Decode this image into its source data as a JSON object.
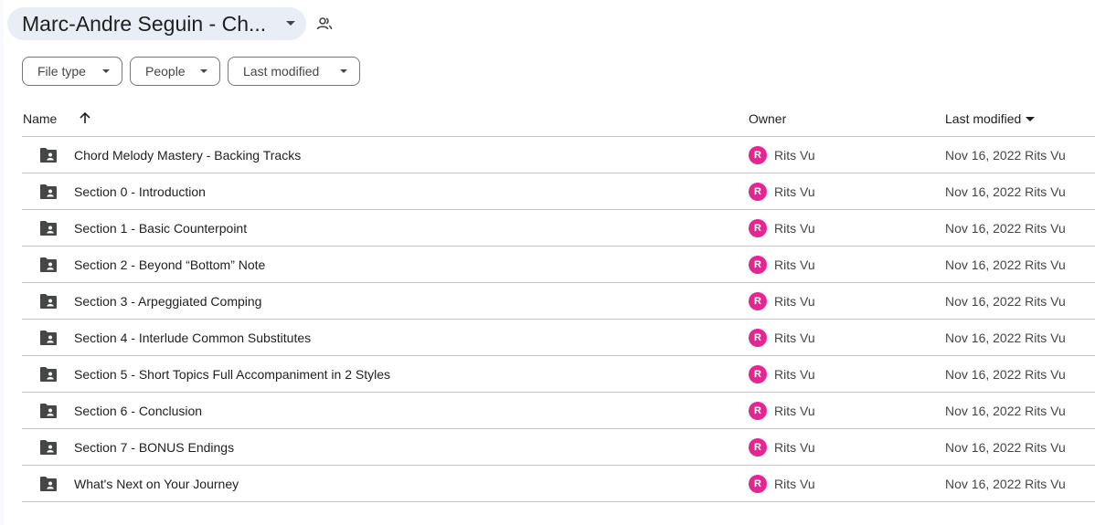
{
  "folder_title": "Marc-Andre Seguin - Ch...",
  "filters": [
    {
      "label": "File type"
    },
    {
      "label": "People"
    },
    {
      "label": "Last modified"
    }
  ],
  "columns": {
    "name": "Name",
    "owner": "Owner",
    "last_modified": "Last modified"
  },
  "files": [
    {
      "name": "Chord Melody Mastery - Backing Tracks",
      "avatar": "R",
      "owner": "Rits Vu",
      "modified": "Nov 16, 2022 Rits Vu"
    },
    {
      "name": "Section 0 - Introduction",
      "avatar": "R",
      "owner": "Rits Vu",
      "modified": "Nov 16, 2022 Rits Vu"
    },
    {
      "name": "Section 1 - Basic Counterpoint",
      "avatar": "R",
      "owner": "Rits Vu",
      "modified": "Nov 16, 2022 Rits Vu"
    },
    {
      "name": "Section 2 - Beyond “Bottom” Note",
      "avatar": "R",
      "owner": "Rits Vu",
      "modified": "Nov 16, 2022 Rits Vu"
    },
    {
      "name": "Section 3 - Arpeggiated Comping",
      "avatar": "R",
      "owner": "Rits Vu",
      "modified": "Nov 16, 2022 Rits Vu"
    },
    {
      "name": "Section 4 - Interlude Common Substitutes",
      "avatar": "R",
      "owner": "Rits Vu",
      "modified": "Nov 16, 2022 Rits Vu"
    },
    {
      "name": "Section 5 - Short Topics Full Accompaniment in 2 Styles",
      "avatar": "R",
      "owner": "Rits Vu",
      "modified": "Nov 16, 2022 Rits Vu"
    },
    {
      "name": "Section 6 - Conclusion",
      "avatar": "R",
      "owner": "Rits Vu",
      "modified": "Nov 16, 2022 Rits Vu"
    },
    {
      "name": "Section 7 - BONUS Endings",
      "avatar": "R",
      "owner": "Rits Vu",
      "modified": "Nov 16, 2022 Rits Vu"
    },
    {
      "name": "What's Next on Your Journey",
      "avatar": "R",
      "owner": "Rits Vu",
      "modified": "Nov 16, 2022 Rits Vu"
    }
  ],
  "icons": {
    "folder": "shared-folder-icon",
    "shared": "people-icon",
    "sort": "arrow-up-icon",
    "dropdown": "caret-down-icon"
  },
  "colors": {
    "chip_bg": "#e9eef6",
    "avatar": "#e52592",
    "divider": "#c7c7c7",
    "filter_border": "#747775"
  }
}
